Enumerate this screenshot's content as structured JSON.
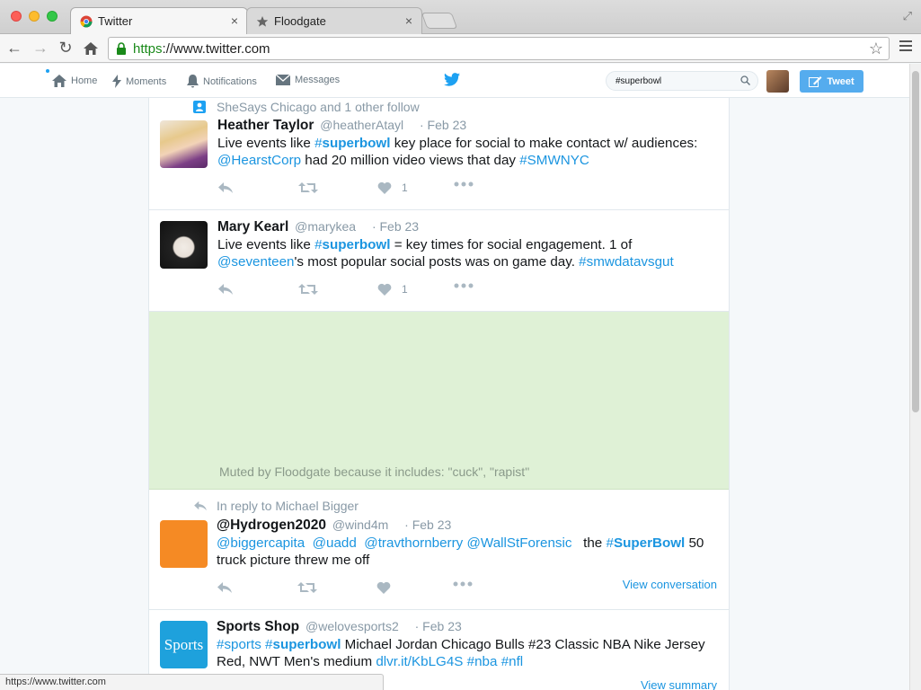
{
  "browser": {
    "tabs": [
      {
        "label": "Twitter",
        "close": "×"
      },
      {
        "label": "Floodgate",
        "close": "×"
      }
    ],
    "url_scheme": "https",
    "url_rest": "://www.twitter.com",
    "status_url": "https://www.twitter.com"
  },
  "nav": {
    "items": [
      "Home",
      "Moments",
      "Notifications",
      "Messages"
    ],
    "search_value": "#superbowl",
    "tweet_label": "Tweet"
  },
  "timeline": {
    "tweets": [
      {
        "context": "SheSays Chicago and 1 other follow",
        "name": "Heather Taylor",
        "handle": "@heatherAtayl",
        "date": "· Feb 23",
        "text_parts": [
          "Live events like ",
          "#",
          "superbowl",
          " key place for social to make contact w/ audiences: ",
          "@HearstCorp",
          " had 20 million video views that day ",
          "#SMWNYC"
        ],
        "likes": "1"
      },
      {
        "name": "Mary Kearl",
        "handle": "@marykea",
        "date": "· Feb 23",
        "text_parts": [
          "Live events like ",
          "#",
          "superbowl",
          " = key times for social engagement. 1 of ",
          "@seventeen",
          "'s most popular social posts was on game day. ",
          "#smwdatavsgut"
        ],
        "likes": "1"
      },
      {
        "muted_text": "Muted by Floodgate because it includes: \"cuck\", \"rapist\""
      },
      {
        "context": "In reply to Michael Bigger",
        "name": "@Hydrogen2020",
        "handle": "@wind4m",
        "date": "· Feb 23",
        "text_parts": [
          "@biggercapita",
          "@uadd",
          "@travthornberry",
          "@WallStForensic",
          "the ",
          "#",
          "SuperBowl",
          " 50 truck picture threw me off"
        ],
        "view": "View conversation"
      },
      {
        "name": "Sports Shop",
        "handle": "@welovesports2",
        "date": "· Feb 23",
        "avatar_text": "Sports",
        "text_parts": [
          "#sports",
          "#",
          "superbowl",
          " Michael Jordan Chicago Bulls #23 Classic NBA Nike Jersey Red, NWT Men's medium ",
          "dlvr.it/KbLG4S",
          "#nba",
          "#nfl"
        ],
        "view": "View summary"
      }
    ]
  },
  "colors": {
    "accent": "#1da1f2",
    "link": "#1b95e0",
    "muted_bg": "#dff1d6",
    "avatar_orange": "#f58a24",
    "avatar_blue": "#1ea1dc"
  }
}
